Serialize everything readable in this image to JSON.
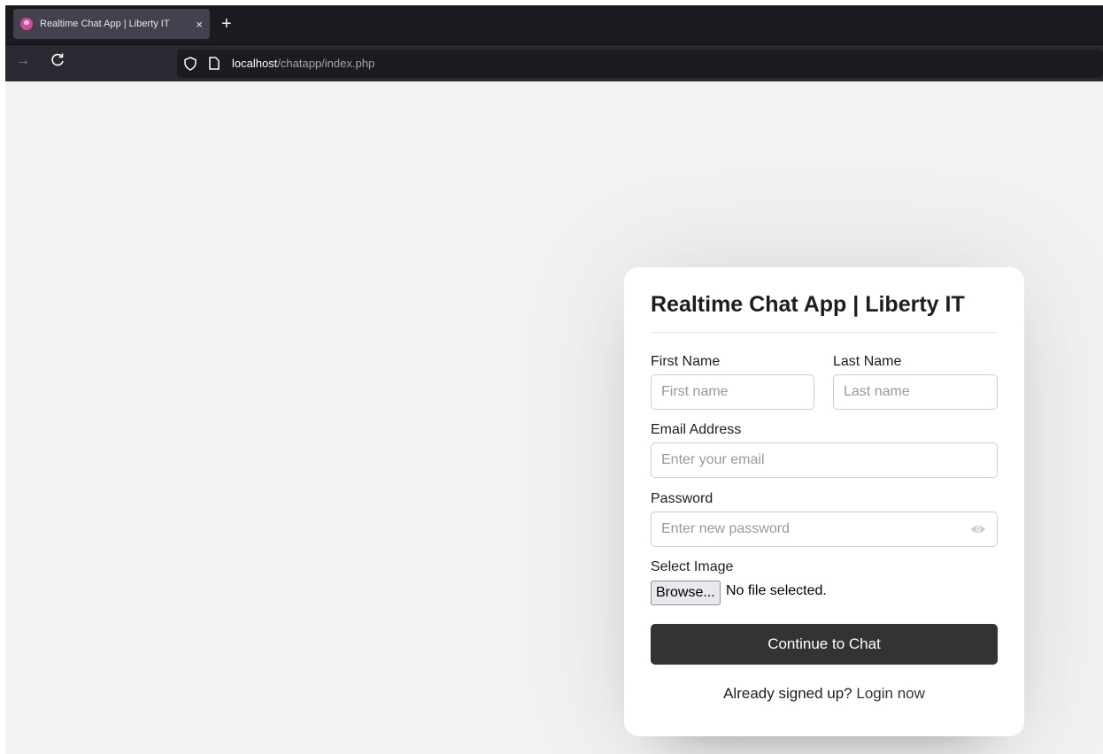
{
  "browser": {
    "tab_title": "Realtime Chat App | Liberty IT",
    "tab_close": "×",
    "new_tab": "+",
    "url_host": "localhost",
    "url_path": "/chatapp/index.php"
  },
  "form": {
    "title": "Realtime Chat App | Liberty IT",
    "first_name_label": "First Name",
    "first_name_placeholder": "First name",
    "last_name_label": "Last Name",
    "last_name_placeholder": "Last name",
    "email_label": "Email Address",
    "email_placeholder": "Enter your email",
    "password_label": "Password",
    "password_placeholder": "Enter new password",
    "image_label": "Select Image",
    "browse_label": "Browse...",
    "file_status": "No file selected.",
    "submit_label": "Continue to Chat",
    "already_text": "Already signed up?",
    "login_link": "Login now"
  },
  "colors": {
    "page_bg": "#f2f2f2",
    "card_bg": "#ffffff",
    "button_bg": "#333333",
    "tabbar_bg": "#1c1b22",
    "navbar_bg": "#2b2a33"
  }
}
